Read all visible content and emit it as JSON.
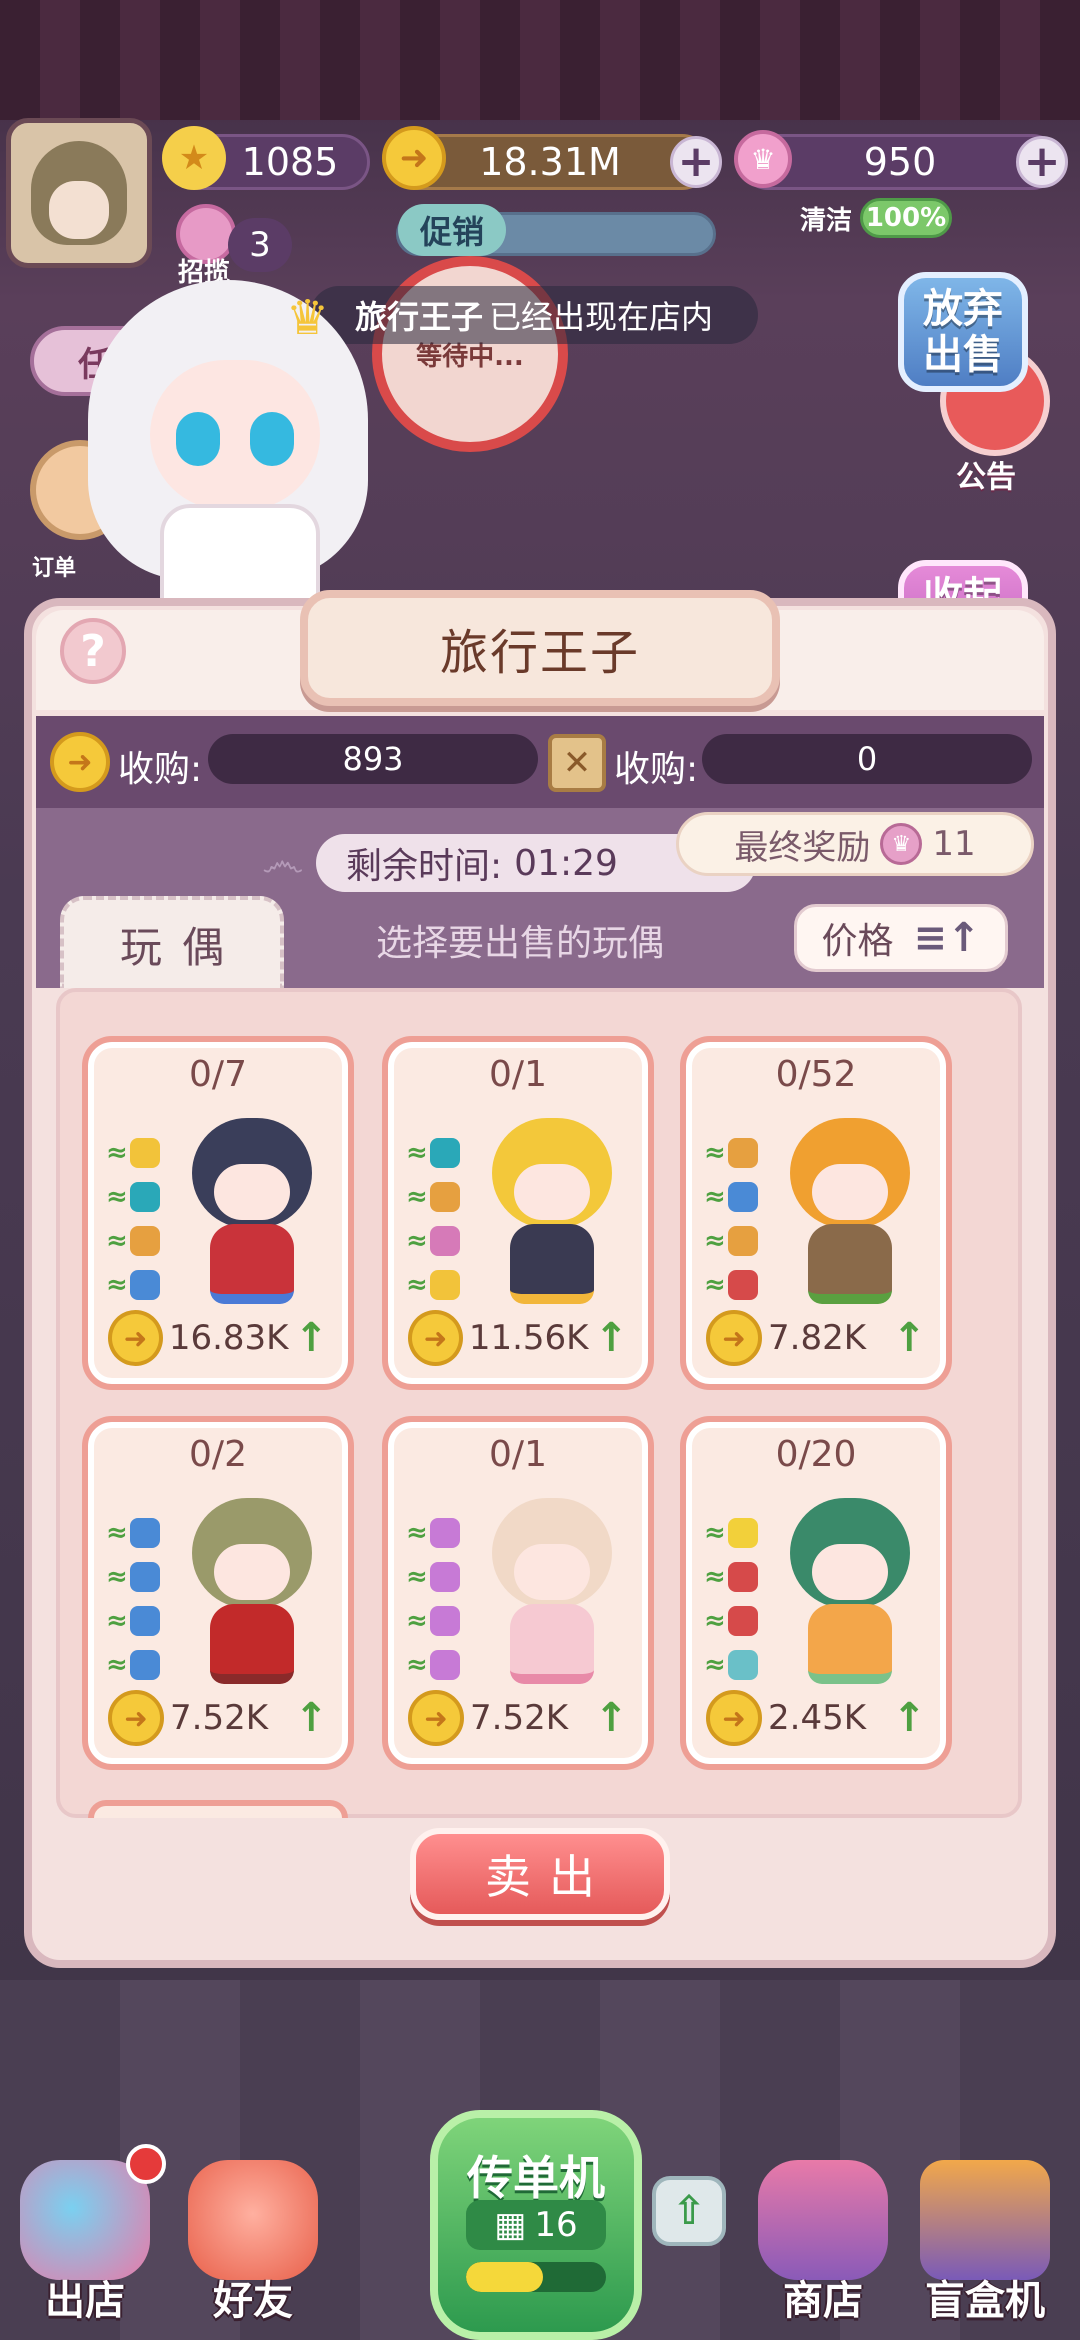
{
  "hud": {
    "stars": "1085",
    "coins": "18.31M",
    "gems": "950",
    "recruit_count": "3",
    "recruit_label": "招揽",
    "promo_label": "促销",
    "clean_label": "清洁",
    "clean_value": "100%",
    "task_label": "任务",
    "order_label": "订单",
    "notice_label": "公告",
    "waiting_label": "等待中...",
    "star_icon": "star-icon",
    "coin_icon": "coin-icon",
    "gem_icon": "crown-gem-icon"
  },
  "announcement": {
    "name": "旅行王子",
    "message": "已经出现在店内"
  },
  "side_buttons": {
    "abandon": "放弃\n出售",
    "collapse": "收起\n界面"
  },
  "panel": {
    "title": "旅行王子",
    "help": "?",
    "coin_bounty_label": "收购:",
    "coin_bounty_value": "893",
    "box_bounty_label": "收购:",
    "box_bounty_value": "0",
    "time_label": "剩余时间:",
    "time_value": "01:29",
    "final_reward_label": "最终奖励",
    "final_reward_value": "11",
    "tab_label": "玩偶",
    "choose_hint": "选择要出售的玩偶",
    "sort_label": "价格",
    "sell_button": "卖出"
  },
  "dolls": [
    {
      "count": "0/7",
      "price": "16.83K",
      "colors": {
        "head": "#3a3e5a",
        "body": "#c9333a",
        "accent": "#4a7ad6"
      }
    },
    {
      "count": "0/1",
      "price": "11.56K",
      "colors": {
        "head": "#f3c83a",
        "body": "#3a3a52",
        "accent": "#f2b63a"
      }
    },
    {
      "count": "0/52",
      "price": "7.82K",
      "colors": {
        "head": "#f0a030",
        "body": "#8a6a4a",
        "accent": "#5aa040"
      }
    },
    {
      "count": "0/2",
      "price": "7.52K",
      "colors": {
        "head": "#9a9a6a",
        "body": "#c22a2a",
        "accent": "#8a2a2a"
      }
    },
    {
      "count": "0/1",
      "price": "7.52K",
      "colors": {
        "head": "#f1d9c7",
        "body": "#f6c9d2",
        "accent": "#e88aa8"
      }
    },
    {
      "count": "0/20",
      "price": "2.45K",
      "colors": {
        "head": "#3a8a6a",
        "body": "#f3a64a",
        "accent": "#7ac28a"
      }
    }
  ],
  "bottom_nav": {
    "go_out": "出店",
    "friends": "好友",
    "flyer_machine": "传单机",
    "flyer_count": "16",
    "flyer_progress": 0.55,
    "shop": "商店",
    "blind_box": "盲盒机"
  }
}
